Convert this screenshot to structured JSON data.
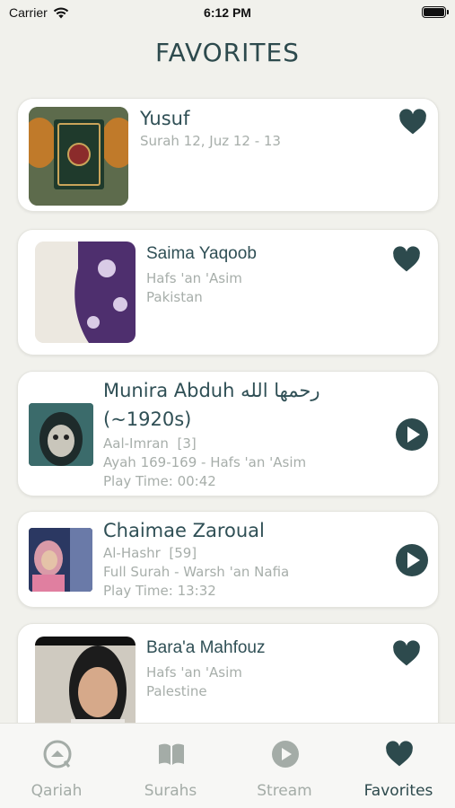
{
  "status": {
    "carrier": "Carrier",
    "time": "6:12 PM"
  },
  "title": "FAVORITES",
  "colors": {
    "accent": "#2d4a4d",
    "muted": "#a7aeaa",
    "background": "#f1f1ec"
  },
  "cards": [
    {
      "title": "Yusuf",
      "lines": [
        "Surah 12, Juz 12 - 13"
      ],
      "action": "heart-icon"
    },
    {
      "title": "Saima Yaqoob",
      "lines": [
        "Hafs 'an 'Asim",
        "Pakistan"
      ],
      "action": "heart-icon"
    },
    {
      "title": "Munira Abduh رحمها الله",
      "title_line2": "(~1920s)",
      "lines": [
        "Aal-Imran  [3]",
        "Ayah 169-169 - Hafs 'an 'Asim",
        "Play Time: 00:42"
      ],
      "action": "play-icon"
    },
    {
      "title": "Chaimae Zaroual",
      "lines": [
        "Al-Hashr  [59]",
        "Full Surah - Warsh 'an Nafia",
        "Play Time: 13:32"
      ],
      "action": "play-icon"
    },
    {
      "title": "Bara'a Mahfouz",
      "lines": [
        "Hafs 'an 'Asim",
        "Palestine"
      ],
      "action": "heart-icon"
    }
  ],
  "tabs": [
    {
      "label": "Qariah",
      "icon": "qariah-icon",
      "active": false
    },
    {
      "label": "Surahs",
      "icon": "book-icon",
      "active": false
    },
    {
      "label": "Stream",
      "icon": "play-circle-icon",
      "active": false
    },
    {
      "label": "Favorites",
      "icon": "heart-icon",
      "active": true
    }
  ]
}
